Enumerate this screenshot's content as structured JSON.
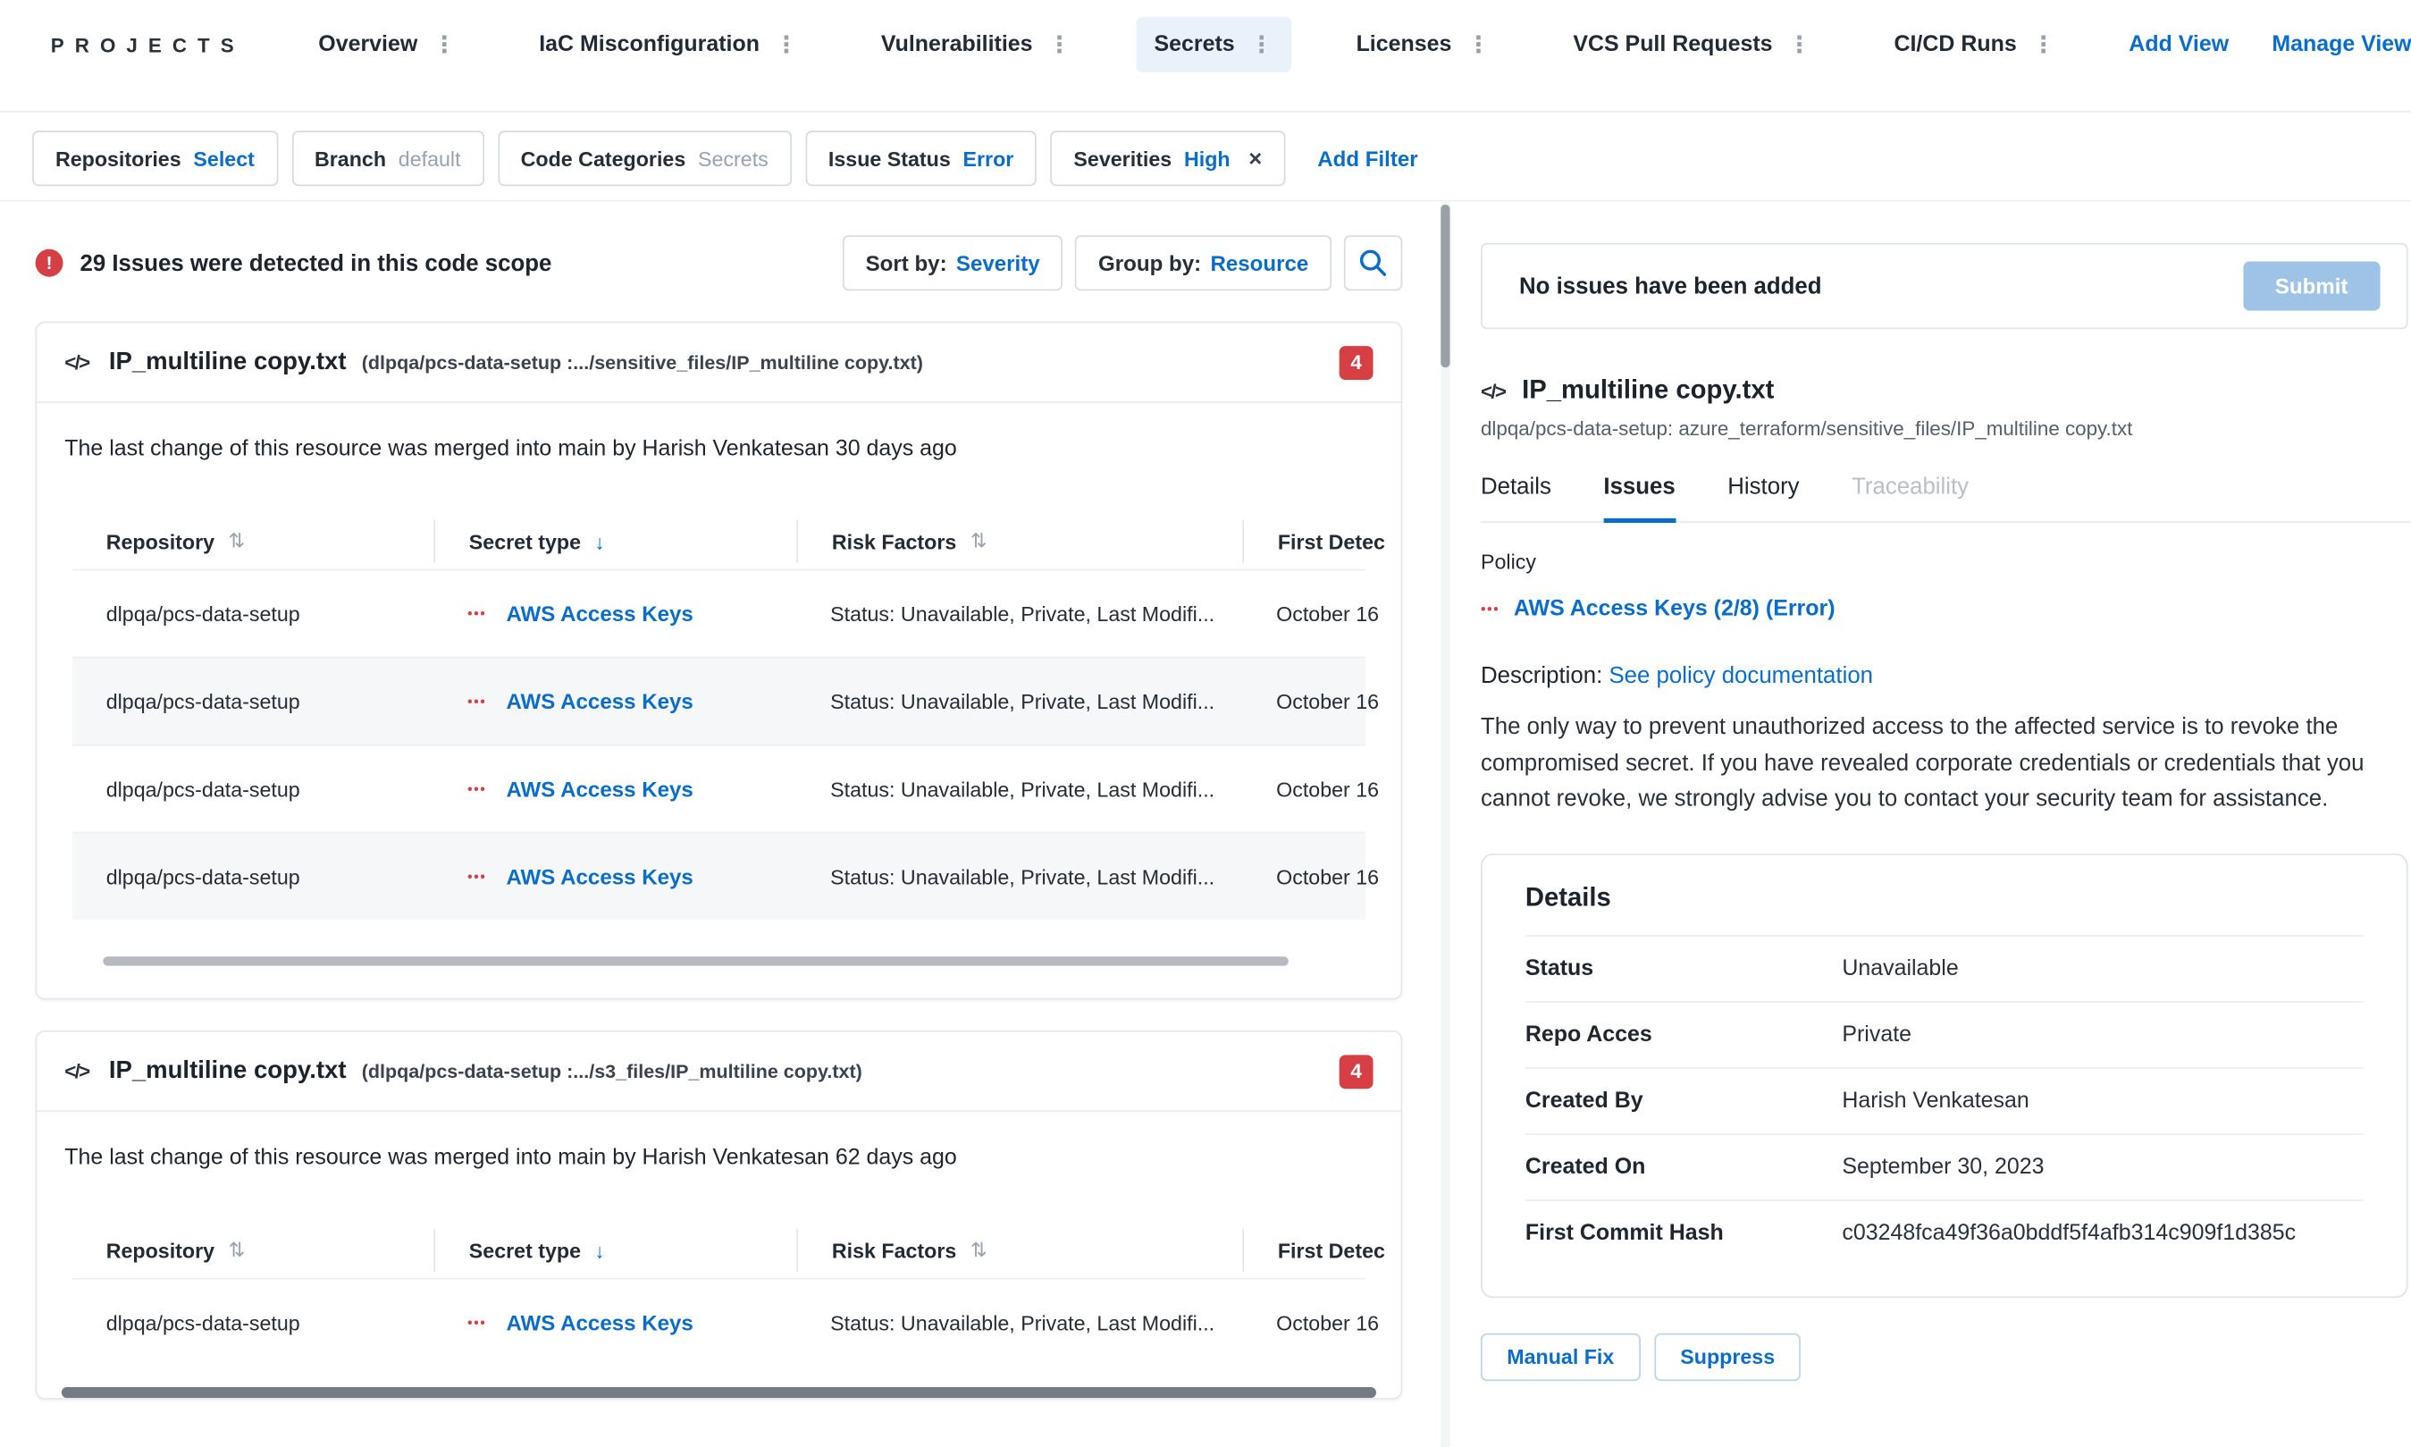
{
  "colors": {
    "accent": "#0a6dc9",
    "error": "#d64045"
  },
  "icons": {
    "code": "</>",
    "menu_dots": "⋮",
    "sort_both": "⇅",
    "sort_desc": "↓",
    "close": "×",
    "secret_mask": "•••",
    "error_mark": "!"
  },
  "nav": {
    "brand": "PROJECTS",
    "tabs": [
      {
        "label": "Overview"
      },
      {
        "label": "IaC Misconfiguration"
      },
      {
        "label": "Vulnerabilities"
      },
      {
        "label": "Secrets"
      },
      {
        "label": "Licenses"
      },
      {
        "label": "VCS Pull Requests"
      },
      {
        "label": "CI/CD Runs"
      }
    ],
    "add_view": "Add View",
    "manage_views": "Manage Views"
  },
  "filters": {
    "chips": [
      {
        "label": "Repositories",
        "value": "Select"
      },
      {
        "label": "Branch",
        "value": "default"
      },
      {
        "label": "Code Categories",
        "value": "Secrets"
      },
      {
        "label": "Issue Status",
        "value": "Error"
      },
      {
        "label": "Severities",
        "value": "High"
      }
    ],
    "add_filter": "Add Filter"
  },
  "toolbar": {
    "summary": "29 Issues were detected in this code scope",
    "sort_by_label": "Sort by:",
    "sort_by_value": "Severity",
    "group_by_label": "Group by:",
    "group_by_value": "Resource"
  },
  "table": {
    "headers": [
      "Repository",
      "Secret type",
      "Risk Factors",
      "First Detec"
    ]
  },
  "cards": [
    {
      "title": "IP_multiline copy.txt",
      "path": "(dlpqa/pcs-data-setup :.../sensitive_files/IP_multiline copy.txt)",
      "badge": "4",
      "summary": "The last change of this resource was merged into main by Harish Venkatesan 30 days ago",
      "rows": [
        {
          "repository": "dlpqa/pcs-data-setup",
          "secret_type": "AWS Access Keys",
          "risk_factors": "Status: Unavailable, Private, Last Modifi...",
          "first_detected": "October 16"
        },
        {
          "repository": "dlpqa/pcs-data-setup",
          "secret_type": "AWS Access Keys",
          "risk_factors": "Status: Unavailable, Private, Last Modifi...",
          "first_detected": "October 16"
        },
        {
          "repository": "dlpqa/pcs-data-setup",
          "secret_type": "AWS Access Keys",
          "risk_factors": "Status: Unavailable, Private, Last Modifi...",
          "first_detected": "October 16"
        },
        {
          "repository": "dlpqa/pcs-data-setup",
          "secret_type": "AWS Access Keys",
          "risk_factors": "Status: Unavailable, Private, Last Modifi...",
          "first_detected": "October 16"
        }
      ]
    },
    {
      "title": "IP_multiline copy.txt",
      "path": "(dlpqa/pcs-data-setup :.../s3_files/IP_multiline copy.txt)",
      "badge": "4",
      "summary": "The last change of this resource was merged into main by Harish Venkatesan 62 days ago",
      "rows": [
        {
          "repository": "dlpqa/pcs-data-setup",
          "secret_type": "AWS Access Keys",
          "risk_factors": "Status: Unavailable, Private, Last Modifi...",
          "first_detected": "October 16"
        }
      ]
    }
  ],
  "panel": {
    "empty_text": "No issues have been added",
    "submit_label": "Submit",
    "resource_title": "IP_multiline copy.txt",
    "resource_path": "dlpqa/pcs-data-setup: azure_terraform/sensitive_files/IP_multiline copy.txt",
    "tabs": [
      {
        "label": "Details"
      },
      {
        "label": "Issues"
      },
      {
        "label": "History"
      },
      {
        "label": "Traceability"
      }
    ],
    "policy_label": "Policy",
    "policy_link": "AWS Access Keys (2/8) (Error)",
    "description_label": "Description:",
    "description_link": "See policy documentation",
    "description_text": "The only way to prevent unauthorized access to the affected service is to revoke the compromised secret. If you have revealed corporate credentials or credentials that you cannot revoke, we strongly advise you to contact your security team for assistance.",
    "details": {
      "title": "Details",
      "rows": [
        {
          "label": "Status",
          "value": "Unavailable"
        },
        {
          "label": "Repo Acces",
          "value": "Private"
        },
        {
          "label": "Created By",
          "value": "Harish Venkatesan"
        },
        {
          "label": "Created On",
          "value": "September 30, 2023"
        },
        {
          "label": "First Commit Hash",
          "value": "c03248fca49f36a0bddf5f4afb314c909f1d385c"
        }
      ]
    },
    "manual_fix_label": "Manual Fix",
    "suppress_label": "Suppress"
  }
}
